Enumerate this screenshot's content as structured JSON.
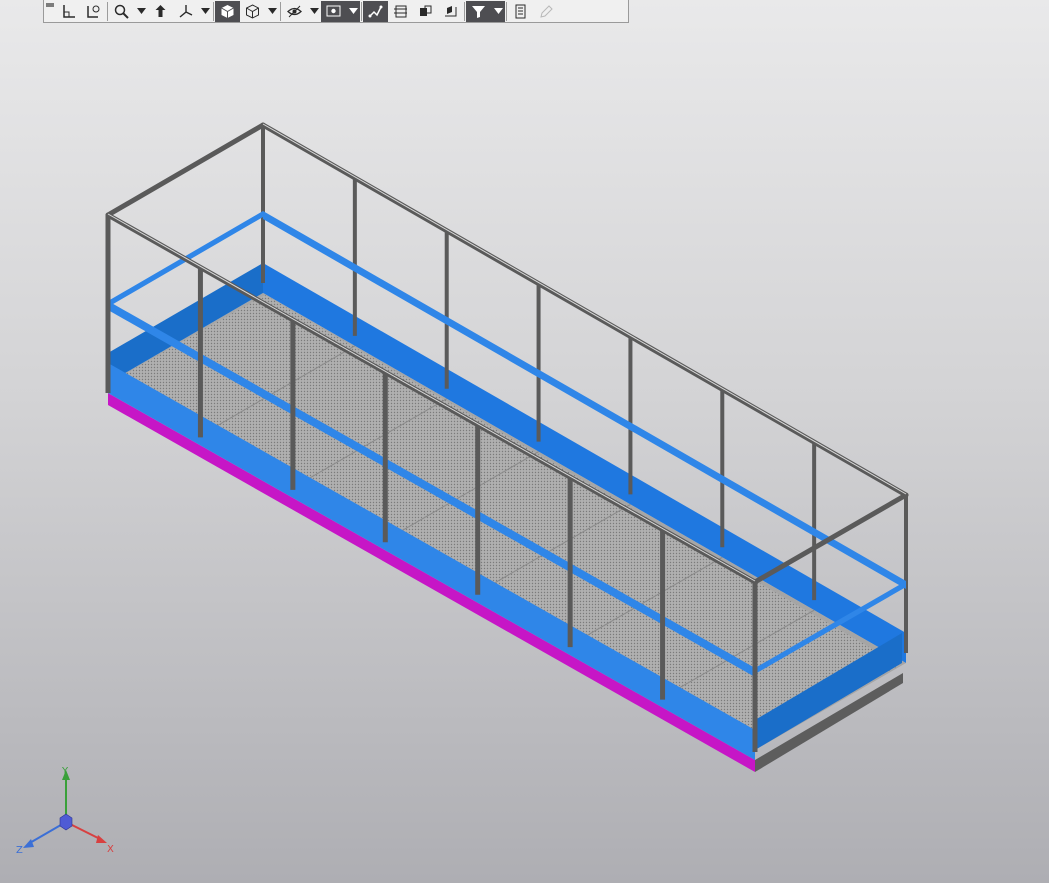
{
  "toolbar": {
    "groups": [
      [
        {
          "name": "orient-icon",
          "active": false,
          "dropdown": false
        },
        {
          "name": "view-settings-icon",
          "active": false,
          "dropdown": false
        }
      ],
      [
        {
          "name": "zoom-icon",
          "active": false,
          "dropdown": true
        },
        {
          "name": "pan-icon",
          "active": false,
          "dropdown": false
        },
        {
          "name": "axes-icon",
          "active": false,
          "dropdown": true
        }
      ],
      [
        {
          "name": "shaded-cube-icon",
          "active": true,
          "dropdown": false
        },
        {
          "name": "wireframe-cube-icon",
          "active": false,
          "dropdown": true
        }
      ],
      [
        {
          "name": "visibility-icon",
          "active": false,
          "dropdown": true
        },
        {
          "name": "hide-objects-icon",
          "active": true,
          "dropdown": true
        }
      ],
      [
        {
          "name": "section-icon",
          "active": true,
          "dropdown": false
        },
        {
          "name": "cut-plane-icon",
          "active": false,
          "dropdown": false
        },
        {
          "name": "explode-icon",
          "active": false,
          "dropdown": false
        },
        {
          "name": "layers-icon",
          "active": false,
          "dropdown": false
        }
      ],
      [
        {
          "name": "filter-icon",
          "active": true,
          "dropdown": true
        }
      ],
      [
        {
          "name": "properties-icon",
          "active": false,
          "dropdown": false
        },
        {
          "name": "pencil-icon",
          "active": false,
          "dropdown": false,
          "disabled": true
        }
      ]
    ]
  },
  "model": {
    "frame_color": "#5a5a5a",
    "rail_color": "#2f86e8",
    "side_color": "#1f78e0",
    "base_color": "#c616c6",
    "floor_color": "#a3a3a3"
  },
  "triad": {
    "x_label": "X",
    "y_label": "Y",
    "z_label": "Z",
    "x_color": "#d84040",
    "y_color": "#3aa03a",
    "z_color": "#3b6fd6"
  }
}
